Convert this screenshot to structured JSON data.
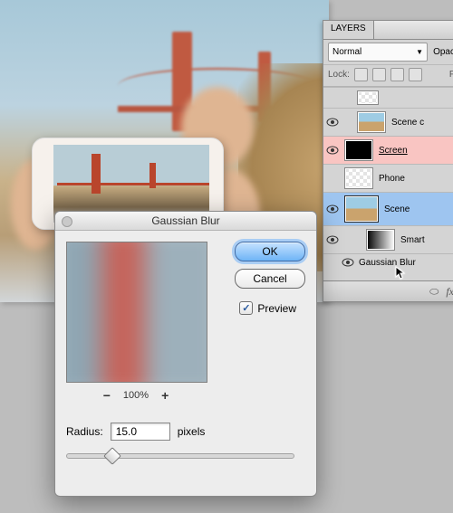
{
  "panel": {
    "tab": "LAYERS",
    "blend_mode": "Normal",
    "opacity_label": "Opac",
    "lock_label": "Lock:",
    "fill_label": "F",
    "layers": [
      {
        "name": "Scene c"
      },
      {
        "name": "Screen"
      },
      {
        "name": "Phone"
      },
      {
        "name": "Scene"
      },
      {
        "name": "Smart"
      }
    ],
    "filter_line": "Gaussian Blur"
  },
  "dialog": {
    "title": "Gaussian Blur",
    "ok": "OK",
    "cancel": "Cancel",
    "preview_label": "Preview",
    "preview_checked": true,
    "zoom": "100%",
    "radius_label": "Radius:",
    "radius_value": "15.0",
    "units": "pixels"
  }
}
